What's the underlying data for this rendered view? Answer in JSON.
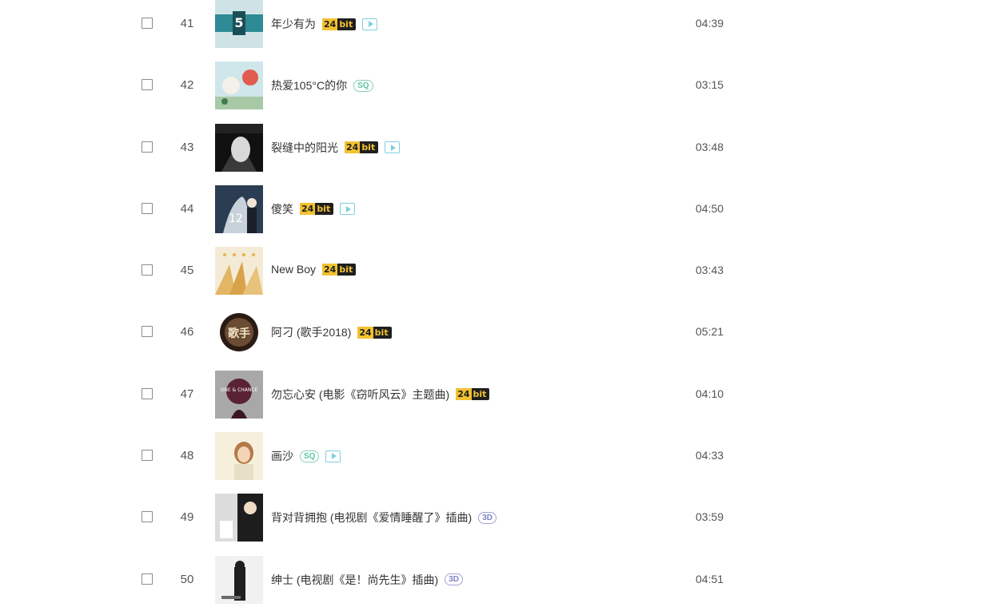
{
  "songs": [
    {
      "index": "41",
      "title": "年少有为",
      "badges": [
        "24bit",
        "mv"
      ],
      "duration": "04:39",
      "cover": "cover-41"
    },
    {
      "index": "42",
      "title": "热爱105°C的你",
      "badges": [
        "sq"
      ],
      "duration": "03:15",
      "cover": "cover-42"
    },
    {
      "index": "43",
      "title": "裂缝中的阳光",
      "badges": [
        "24bit",
        "mv"
      ],
      "duration": "03:48",
      "cover": "cover-43"
    },
    {
      "index": "44",
      "title": "傻笑",
      "badges": [
        "24bit",
        "mv"
      ],
      "duration": "04:50",
      "cover": "cover-44"
    },
    {
      "index": "45",
      "title": "New Boy",
      "badges": [
        "24bit"
      ],
      "duration": "03:43",
      "cover": "cover-45"
    },
    {
      "index": "46",
      "title": "阿刁 (歌手2018)",
      "badges": [
        "24bit"
      ],
      "duration": "05:21",
      "cover": "cover-46"
    },
    {
      "index": "47",
      "title": "勿忘心安 (电影《窃听风云》主题曲)",
      "badges": [
        "24bit"
      ],
      "duration": "04:10",
      "cover": "cover-47"
    },
    {
      "index": "48",
      "title": "画沙",
      "badges": [
        "sq",
        "mv"
      ],
      "duration": "04:33",
      "cover": "cover-48"
    },
    {
      "index": "49",
      "title": "背对背拥抱 (电视剧《爱情睡醒了》插曲)",
      "badges": [
        "3d"
      ],
      "duration": "03:59",
      "cover": "cover-49"
    },
    {
      "index": "50",
      "title": "绅士 (电视剧《是！尚先生》插曲)",
      "badges": [
        "3d"
      ],
      "duration": "04:51",
      "cover": "cover-50"
    }
  ],
  "badge_text": {
    "bit_num": "24",
    "bit_txt": "bit",
    "sq": "SQ",
    "3d": "3D"
  },
  "cover_art": {
    "41": "5",
    "44": "12",
    "46": "歌手",
    "47": "ONE & CHANCE"
  },
  "colors": {
    "badge_gold": "#f2c230",
    "badge_dark": "#1f1f1f",
    "sq_green": "#5cc4a5",
    "mv_cyan": "#7fcfe0",
    "threeD_purple": "#7d82c4"
  }
}
